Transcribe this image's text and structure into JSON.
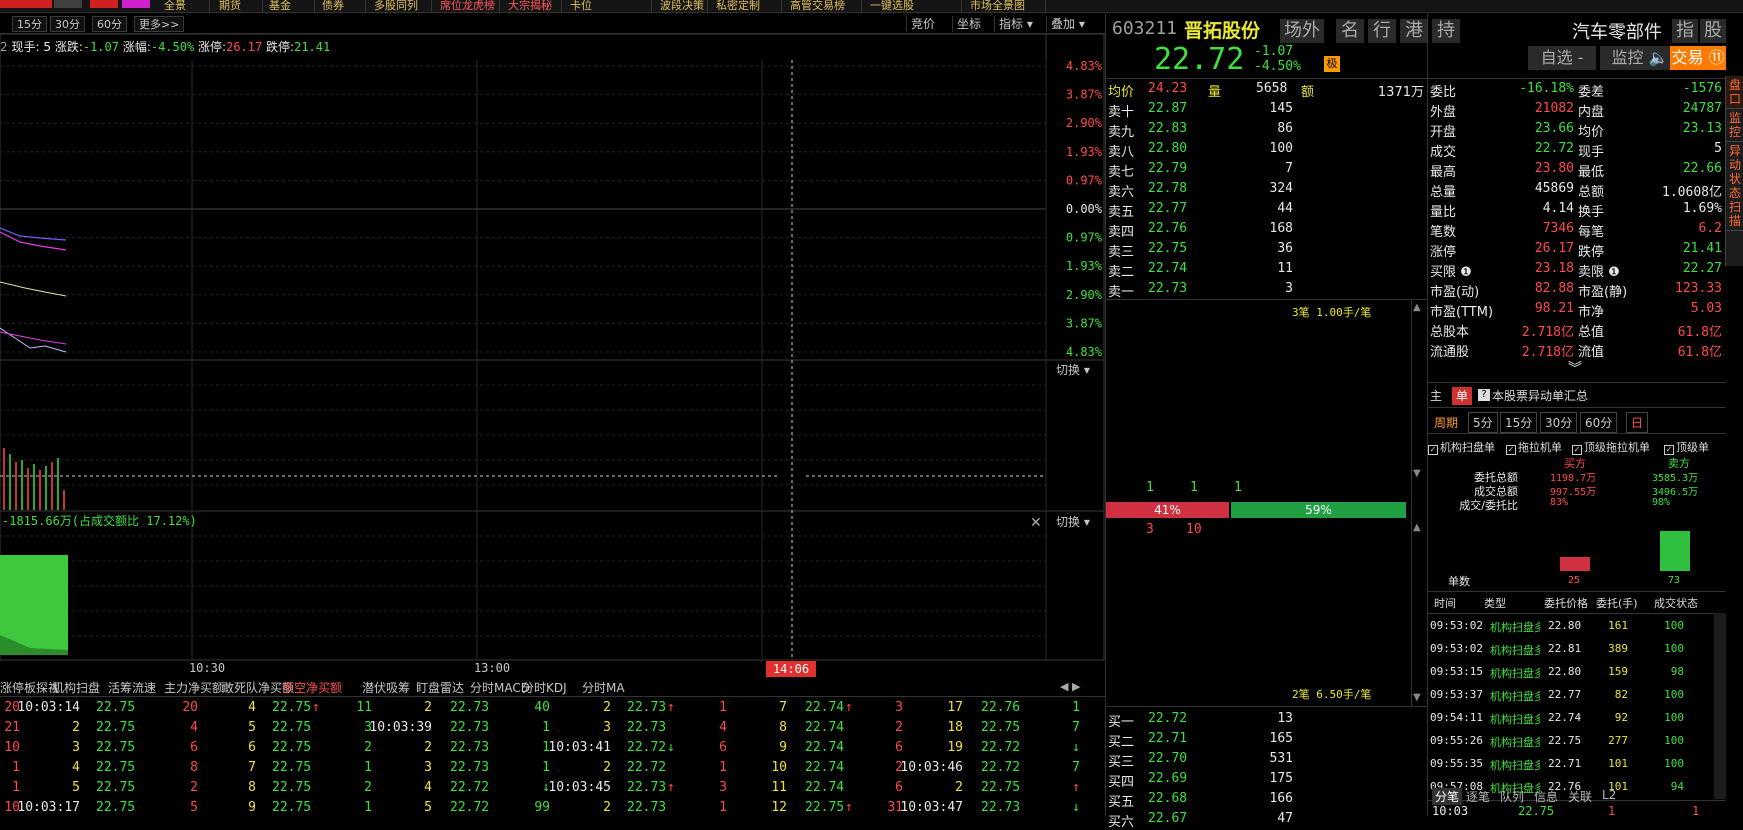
{
  "topbar": {
    "items": [
      "全景",
      "期货",
      "基金",
      "债券",
      "多股同列",
      "席位龙虎榜",
      "大宗揭秘",
      "卡位",
      "波段决策",
      "私密定制",
      "高管交易榜",
      "一键选股",
      "市场全景图"
    ]
  },
  "timeframes": [
    "15分",
    "30分",
    "60分",
    "更多>>"
  ],
  "chart_tools": [
    "竞价",
    "坐标",
    "指标 ▾",
    "叠加 ▾"
  ],
  "infoline": {
    "prefix": "2",
    "now_hand_label": "现手:",
    "now_hand": "5",
    "change_label": "涨跌:",
    "change": "-1.07",
    "pct_label": "涨幅:",
    "pct": "-4.50%",
    "limit_up_label": "涨停:",
    "limit_up": "26.17",
    "limit_down_label": "跌停:",
    "limit_down": "21.41"
  },
  "chart_data": {
    "type": "line",
    "x_ticks": [
      "10:30",
      "13:00",
      "14:06"
    ],
    "pct_ticks": [
      "4.83%",
      "3.87%",
      "2.90%",
      "1.93%",
      "0.97%",
      "0.00%",
      "0.97%",
      "1.93%",
      "2.90%",
      "3.87%",
      "4.83%"
    ],
    "pct_ticks_red_count": 5,
    "ylim_pct": [
      -4.83,
      4.83
    ],
    "switch_label": "切换 ▾",
    "money_flow_label": "-1815.66万(占成交额比 17.12%)"
  },
  "tape": {
    "tabs": [
      "涨停板探视",
      "机构扫盘",
      "活筹流速",
      "主力净买额",
      "敢死队净买额",
      "多空净买额",
      "潜伏吸筹",
      "盯盘雷达",
      "分时MACD",
      "分时KDJ",
      "分时MA"
    ],
    "active_tab": "多空净买额",
    "rows": [
      [
        "20",
        "10:03:14",
        "22.75",
        "20",
        "4",
        "22.75",
        "↑",
        "11",
        "2",
        "22.73",
        "40",
        "2",
        "22.73",
        "↑",
        "1",
        "7",
        "22.74",
        "↑",
        "3",
        "17",
        "22.76",
        "1"
      ],
      [
        "21",
        "2",
        "22.75",
        "4",
        "5",
        "22.75",
        "",
        "3",
        "10:03:39",
        "22.73",
        "1",
        "3",
        "22.73",
        "",
        "4",
        "8",
        "22.74",
        "",
        "2",
        "18",
        "22.75",
        "7"
      ],
      [
        "10",
        "3",
        "22.75",
        "6",
        "6",
        "22.75",
        "",
        "2",
        "2",
        "22.73",
        "1",
        "10:03:41",
        "22.72",
        "↓",
        "6",
        "9",
        "22.74",
        "",
        "6",
        "19",
        "22.72",
        "↓"
      ],
      [
        "1",
        "4",
        "22.75",
        "8",
        "7",
        "22.75",
        "",
        "1",
        "3",
        "22.73",
        "1",
        "2",
        "22.72",
        "",
        "1",
        "10",
        "22.74",
        "",
        "2",
        "10:03:46",
        "22.72",
        "7"
      ],
      [
        "1",
        "5",
        "22.75",
        "2",
        "8",
        "22.75",
        "",
        "2",
        "4",
        "22.72",
        "↓",
        "10:03:45",
        "22.73",
        "↑",
        "3",
        "11",
        "22.74",
        "",
        "6",
        "2",
        "22.75",
        "↑"
      ],
      [
        "10",
        "10:03:17",
        "22.75",
        "5",
        "9",
        "22.75",
        "",
        "1",
        "5",
        "22.72",
        "99",
        "2",
        "22.73",
        "",
        "1",
        "12",
        "22.75",
        "↑",
        "31",
        "10:03:47",
        "22.73",
        "↓"
      ]
    ]
  },
  "quote": {
    "code": "603211",
    "name": "晋拓股份",
    "tags": [
      "场外",
      "名",
      "行",
      "港",
      "持"
    ],
    "industry": "汽车零部件",
    "industry_tags": [
      "指",
      "股"
    ],
    "price": "22.72",
    "change": "-1.07",
    "change_pct": "-4.50%",
    "badge": "极",
    "buttons": {
      "watch": "自选 -",
      "monitor": "监控 🔈",
      "trade": "交易 ⑪"
    },
    "avg_label": "均价",
    "avg": "24.23",
    "vol_label": "量",
    "vol": "5658",
    "amt_label": "额",
    "amt": "1371万",
    "sells": [
      {
        "label": "卖十",
        "price": "22.87",
        "vol": "145"
      },
      {
        "label": "卖九",
        "price": "22.83",
        "vol": "86"
      },
      {
        "label": "卖八",
        "price": "22.80",
        "vol": "100"
      },
      {
        "label": "卖七",
        "price": "22.79",
        "vol": "7"
      },
      {
        "label": "卖六",
        "price": "22.78",
        "vol": "324"
      },
      {
        "label": "卖五",
        "price": "22.77",
        "vol": "44"
      },
      {
        "label": "卖四",
        "price": "22.76",
        "vol": "168"
      },
      {
        "label": "卖三",
        "price": "22.75",
        "vol": "36"
      },
      {
        "label": "卖二",
        "price": "22.74",
        "vol": "11"
      },
      {
        "label": "卖一",
        "price": "22.73",
        "vol": "3"
      }
    ],
    "queue_top": "3笔 1.00手/笔",
    "queue_bottom": "2笔 6.50手/笔",
    "queue_nums_top": [
      "1",
      "1",
      "1"
    ],
    "queue_nums_bottom": [
      "3",
      "10"
    ],
    "ratio_left": "41%",
    "ratio_right": "59%",
    "ratio_left_value": 0.41,
    "buys": [
      {
        "label": "买一",
        "price": "22.72",
        "vol": "13"
      },
      {
        "label": "买二",
        "price": "22.71",
        "vol": "165"
      },
      {
        "label": "买三",
        "price": "22.70",
        "vol": "531"
      },
      {
        "label": "买四",
        "price": "22.69",
        "vol": "175"
      },
      {
        "label": "买五",
        "price": "22.68",
        "vol": "166"
      },
      {
        "label": "买六",
        "price": "22.67",
        "vol": "47"
      }
    ]
  },
  "stats": [
    {
      "l1": "委比",
      "v1": "-16.18%",
      "c1": "grn",
      "l2": "委差",
      "v2": "-1576",
      "c2": "grn"
    },
    {
      "l1": "外盘",
      "v1": "21082",
      "c1": "red",
      "l2": "内盘",
      "v2": "24787",
      "c2": "grn"
    },
    {
      "l1": "开盘",
      "v1": "23.66",
      "c1": "grn",
      "l2": "均价",
      "v2": "23.13",
      "c2": "grn"
    },
    {
      "l1": "成交",
      "v1": "22.72",
      "c1": "grn",
      "l2": "现手",
      "v2": "5",
      "c2": "wht"
    },
    {
      "l1": "最高",
      "v1": "23.80",
      "c1": "red",
      "l2": "最低",
      "v2": "22.66",
      "c2": "grn"
    },
    {
      "l1": "总量",
      "v1": "45869",
      "c1": "wht",
      "l2": "总额",
      "v2": "1.0608亿",
      "c2": "wht"
    },
    {
      "l1": "量比",
      "v1": "4.14",
      "c1": "wht",
      "l2": "换手",
      "v2": "1.69%",
      "c2": "wht"
    },
    {
      "l1": "笔数",
      "v1": "7346",
      "c1": "red",
      "l2": "每笔",
      "v2": "6.2",
      "c2": "red"
    },
    {
      "l1": "涨停",
      "v1": "26.17",
      "c1": "red",
      "l2": "跌停",
      "v2": "21.41",
      "c2": "grn"
    },
    {
      "l1": "买限 ❶",
      "v1": "23.18",
      "c1": "red",
      "l2": "卖限 ❶",
      "v2": "22.27",
      "c2": "grn"
    },
    {
      "l1": "市盈(动)",
      "v1": "82.88",
      "c1": "red",
      "l2": "市盈(静)",
      "v2": "123.33",
      "c2": "red"
    },
    {
      "l1": "市盈(TTM)",
      "v1": "98.21",
      "c1": "red",
      "l2": "市净",
      "v2": "5.03",
      "c2": "red"
    },
    {
      "l1": "总股本",
      "v1": "2.718亿",
      "c1": "red",
      "l2": "总值",
      "v2": "61.8亿",
      "c2": "red"
    },
    {
      "l1": "流通股",
      "v1": "2.718亿",
      "c1": "red",
      "l2": "流值",
      "v2": "61.8亿",
      "c2": "red"
    }
  ],
  "expand_icon": "︾",
  "order_panel": {
    "tabs": [
      "主",
      "单"
    ],
    "title": "本股票异动单汇总",
    "period_label": "周期",
    "periods": [
      "5分",
      "15分",
      "30分",
      "60分",
      "日"
    ],
    "filters": [
      "机构扫盘单",
      "拖拉机单",
      "顶级拖拉机单",
      "顶级单"
    ],
    "buy_head": "买方",
    "sell_head": "卖方",
    "summary": [
      {
        "label": "委托总额",
        "buy": "1198.7万",
        "sell": "3585.3万"
      },
      {
        "label": "成交总额",
        "buy": "997.55万",
        "sell": "3496.5万"
      },
      {
        "label": "成交/委托比",
        "buy": "83%",
        "sell": "98%"
      }
    ],
    "count_label": "单数",
    "buy_count": "25",
    "sell_count": "73",
    "buy_count_value": 25,
    "sell_count_value": 73,
    "columns": [
      "时间",
      "类型",
      "委托价格",
      "委托(手)",
      "成交状态"
    ],
    "rows": [
      [
        "09:53:02",
        "机构扫盘多",
        "22.80",
        "161",
        "100"
      ],
      [
        "09:53:02",
        "机构扫盘多",
        "22.81",
        "389",
        "100"
      ],
      [
        "09:53:15",
        "机构扫盘多",
        "22.80",
        "159",
        "98"
      ],
      [
        "09:53:37",
        "机构扫盘多",
        "22.77",
        "82",
        "100"
      ],
      [
        "09:54:11",
        "机构扫盘多",
        "22.74",
        "92",
        "100"
      ],
      [
        "09:55:26",
        "机构扫盘多",
        "22.75",
        "277",
        "100"
      ],
      [
        "09:55:35",
        "机构扫盘多",
        "22.71",
        "101",
        "100"
      ],
      [
        "09:57:08",
        "机构扫盘多",
        "22.76",
        "101",
        "94"
      ]
    ]
  },
  "bottom_tabs": [
    "分笔",
    "逐笔",
    "队列",
    "信息",
    "关联",
    "L2"
  ],
  "bottom_row": [
    "10:03",
    "22.75",
    "1",
    "1"
  ],
  "side_tabs": [
    "盘口",
    "监控",
    "异动状态扫描"
  ]
}
